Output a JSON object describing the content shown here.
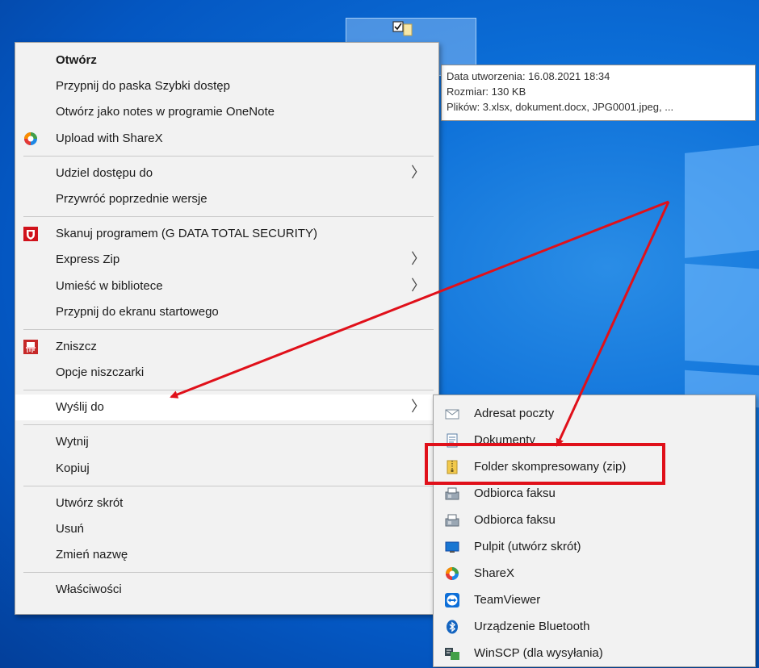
{
  "tooltip": {
    "line1": "Data utworzenia: 16.08.2021 18:34",
    "line2": "Rozmiar: 130 KB",
    "line3": "Plików: 3.xlsx, dokument.docx, JPG0001.jpeg, ..."
  },
  "menu": {
    "open": "Otwórz",
    "pin_quick": "Przypnij do paska Szybki dostęp",
    "onenote": "Otwórz jako notes w programie OneNote",
    "sharex_upload": "Upload with ShareX",
    "share_with": "Udziel dostępu do",
    "restore": "Przywróć poprzednie wersje",
    "scan": "Skanuj programem (G DATA TOTAL SECURITY)",
    "express_zip": "Express Zip",
    "library": "Umieść w bibliotece",
    "pin_start": "Przypnij do ekranu startowego",
    "shred": "Zniszcz",
    "shred_options": "Opcje niszczarki",
    "send_to": "Wyślij do",
    "cut": "Wytnij",
    "copy": "Kopiuj",
    "shortcut": "Utwórz skrót",
    "delete": "Usuń",
    "rename": "Zmień nazwę",
    "properties": "Właściwości",
    "chevron": "〉"
  },
  "submenu": {
    "mail": "Adresat poczty",
    "documents": "Dokumenty",
    "zip": "Folder skompresowany (zip)",
    "fax1": "Odbiorca faksu",
    "fax2": "Odbiorca faksu",
    "desktop": "Pulpit (utwórz skrót)",
    "sharex": "ShareX",
    "teamviewer": "TeamViewer",
    "bluetooth": "Urządzenie Bluetooth",
    "winscp": "WinSCP (dla wysyłania)"
  },
  "colors": {
    "accent_red": "#e0101a",
    "menu_bg": "#f2f2f2",
    "desktop_blue": "#0a63d0"
  }
}
